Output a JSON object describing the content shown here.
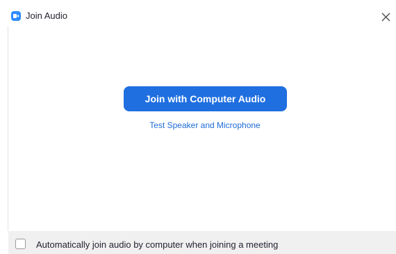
{
  "window": {
    "title": "Join Audio",
    "close_icon": "close-icon",
    "app_icon": "zoom-camera-icon"
  },
  "main": {
    "join_button_label": "Join with Computer Audio",
    "test_link_label": "Test Speaker and Microphone"
  },
  "footer": {
    "checkbox_checked": false,
    "checkbox_label": "Automatically join audio by computer when joining a meeting"
  },
  "colors": {
    "accent": "#1f6fe0",
    "link": "#1d6bd6",
    "footer_bg": "#f0f0f0"
  }
}
